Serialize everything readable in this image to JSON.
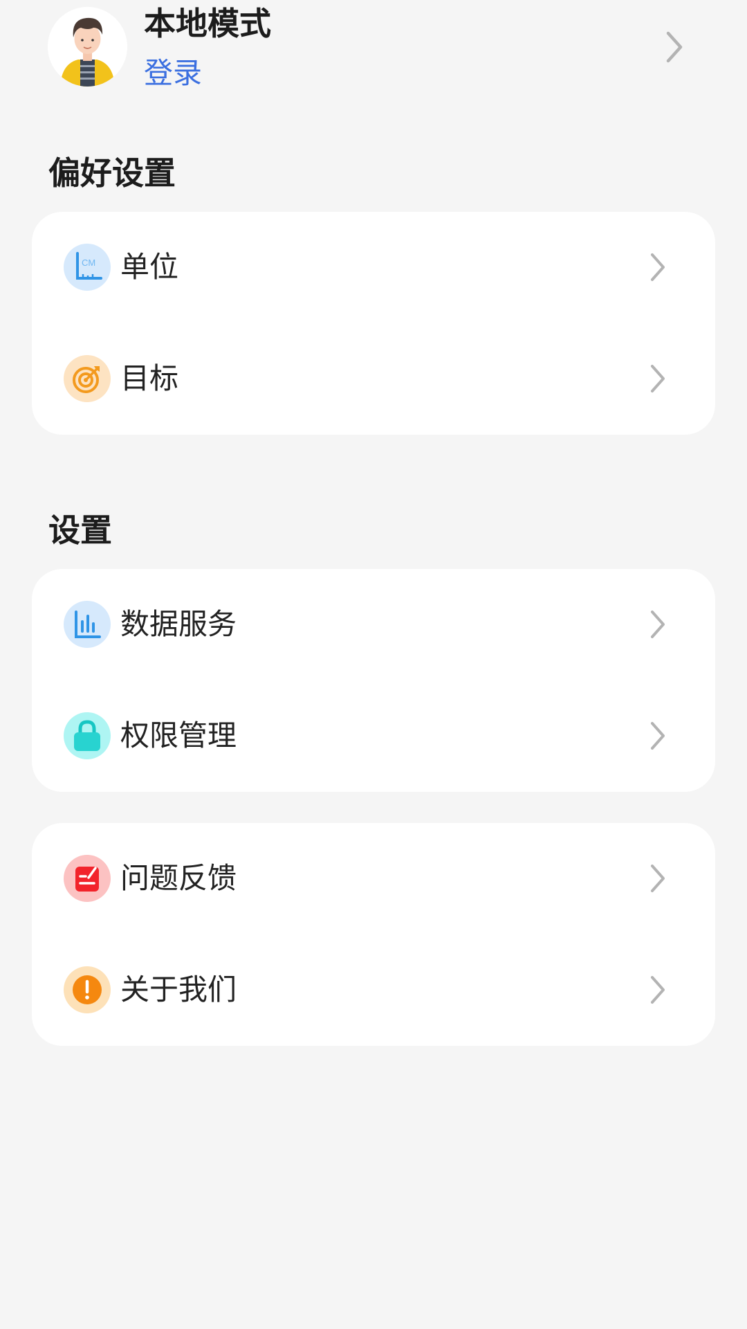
{
  "profile": {
    "name": "本地模式",
    "login": "登录"
  },
  "preferences": {
    "title": "偏好设置",
    "items": [
      {
        "label": "单位",
        "icon": "ruler-cm-icon"
      },
      {
        "label": "目标",
        "icon": "target-icon"
      }
    ]
  },
  "settings": {
    "title": "设置",
    "items": [
      {
        "label": "数据服务",
        "icon": "bar-chart-icon"
      },
      {
        "label": "权限管理",
        "icon": "lock-icon"
      }
    ]
  },
  "misc": {
    "items": [
      {
        "label": "问题反馈",
        "icon": "feedback-icon"
      },
      {
        "label": "关于我们",
        "icon": "info-icon"
      }
    ]
  },
  "colors": {
    "accent": "#3b6fe0",
    "background": "#f5f5f5",
    "card": "#ffffff"
  }
}
